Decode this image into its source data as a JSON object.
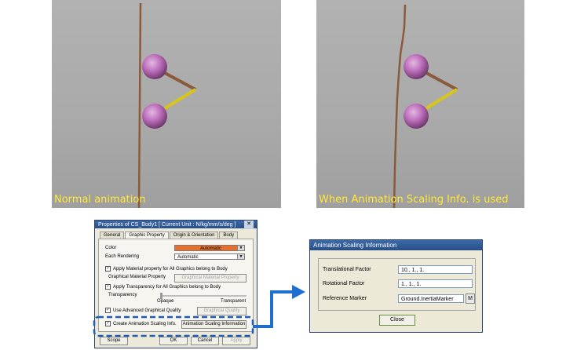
{
  "scenes": {
    "left_caption": "Normal animation",
    "right_caption": "When Animation Scaling Info. is used"
  },
  "properties_window": {
    "title": "Properties of CS_Body1 [ Current Unit : N/kg/mm/s/deg ]",
    "close_symbol": "✕",
    "tabs": [
      "General",
      "Graphic Property",
      "Origin & Orientation",
      "Body"
    ],
    "color_label": "Color",
    "color_value": "Automatic",
    "each_rendering_label": "Each Rendering",
    "each_rendering_value": "Automatic",
    "apply_material_label": "Apply Material property for All Graphics belong to Body",
    "graphical_material_label": "Graphical Material Property",
    "graphical_material_button": "Graphical Material Property",
    "apply_transparency_label": "Apply Transparency for All Graphics belong to Body",
    "transparency_label": "Transparency",
    "opaque_label": "Opaque",
    "transparent_label": "Transparent",
    "advanced_quality_label": "Use Advanced Graphical Quality",
    "advanced_quality_button": "Graphical Quality",
    "create_scaling_label": "Create Animation Scaling Info.",
    "scaling_info_button": "Animation Scaling Information",
    "footer_buttons": [
      "Scope",
      "OK",
      "Cancel",
      "Apply"
    ],
    "accent_color": "#e8702a"
  },
  "scaling_dialog": {
    "title": "Animation Scaling Information",
    "translational_label": "Translational Factor",
    "translational_value": "10., 1., 1.",
    "rotational_label": "Rotational Factor",
    "rotational_value": "1., 1., 1.",
    "reference_label": "Reference Marker",
    "reference_value": "Ground.InertiaMarker",
    "marker_button": "M",
    "close_button": "Close"
  },
  "colors": {
    "caption": "#ffe838",
    "highlight_dash": "#1f5db5",
    "arrow": "#1f6fd1",
    "sphere": "#b96ab8",
    "rod": "#d8c51a",
    "pole": "#8a5a3a"
  }
}
